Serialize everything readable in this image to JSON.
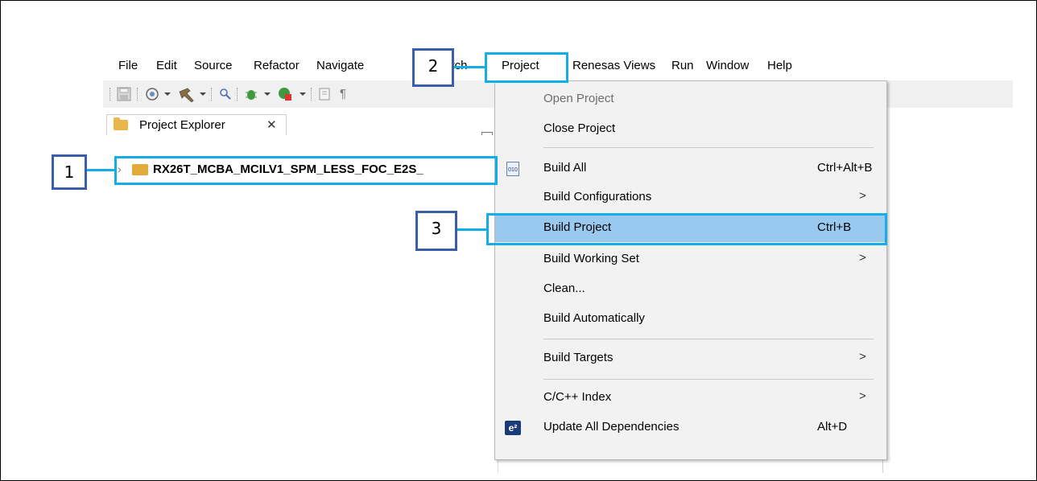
{
  "menubar": {
    "items": [
      "File",
      "Edit",
      "Source",
      "Refactor",
      "Navigate",
      "Search",
      "Project",
      "Renesas Views",
      "Run",
      "Window",
      "Help"
    ]
  },
  "toolbar": {
    "icons": [
      "save-icon",
      "build-target-icon",
      "build-hammer-icon",
      "search-reference-icon",
      "debug-icon",
      "run-icon",
      "show-whitespace-icon"
    ]
  },
  "explorer": {
    "tab_label": "Project Explorer",
    "close_glyph": "✕",
    "project_name": "RX26T_MCBA_MCILV1_SPM_LESS_FOC_E2S_"
  },
  "project_menu": {
    "items": [
      {
        "label": "Open Project",
        "shortcut": "",
        "submenu": false,
        "disabled": true
      },
      {
        "label": "Close Project",
        "shortcut": "",
        "submenu": false,
        "disabled": false
      },
      {
        "label": "Build All",
        "shortcut": "Ctrl+Alt+B",
        "submenu": false,
        "disabled": false,
        "icon": "build-all-icon"
      },
      {
        "label": "Build Configurations",
        "shortcut": "",
        "submenu": true,
        "disabled": false
      },
      {
        "label": "Build Project",
        "shortcut": "Ctrl+B",
        "submenu": false,
        "disabled": false,
        "highlighted": true
      },
      {
        "label": "Build Working Set",
        "shortcut": "",
        "submenu": true,
        "disabled": false
      },
      {
        "label": "Clean...",
        "shortcut": "",
        "submenu": false,
        "disabled": false
      },
      {
        "label": "Build Automatically",
        "shortcut": "",
        "submenu": false,
        "disabled": false
      },
      {
        "label": "Build Targets",
        "shortcut": "",
        "submenu": true,
        "disabled": false
      },
      {
        "label": "C/C++ Index",
        "shortcut": "",
        "submenu": true,
        "disabled": false
      },
      {
        "label": "Update All Dependencies",
        "shortcut": "Alt+D",
        "submenu": false,
        "disabled": false,
        "icon": "e2-icon"
      }
    ],
    "submenu_arrow": ">",
    "icon_text_010": "010",
    "icon_text_e2": "e²"
  },
  "callouts": {
    "step1": "1",
    "step2": "2",
    "step3": "3"
  },
  "colors": {
    "highlight_frame": "#13aee8",
    "callout_border": "#3a5fa8",
    "menu_selection": "#99c9ef"
  }
}
